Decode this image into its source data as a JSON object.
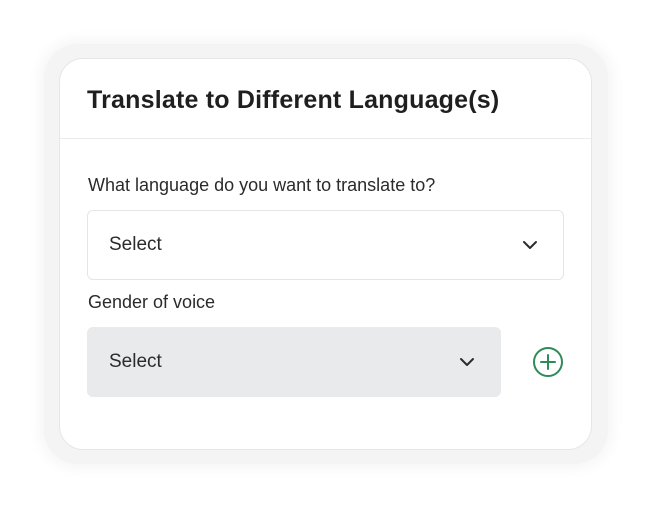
{
  "card": {
    "title": "Translate to Different Language(s)"
  },
  "language_field": {
    "label": "What language do you want to translate to?",
    "value": "Select",
    "icon": "chevron-down-icon"
  },
  "gender_field": {
    "label": "Gender of voice",
    "value": "Select",
    "icon": "chevron-down-icon"
  },
  "add_button": {
    "icon": "plus-circle-icon",
    "color": "#2e8b57"
  },
  "colors": {
    "title_text": "#1f1f1f",
    "gender_select_bg": "#e9eaec",
    "accent_green": "#2e8b57"
  }
}
